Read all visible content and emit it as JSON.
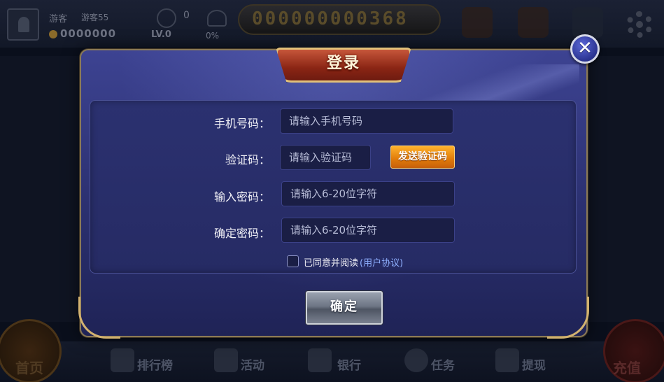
{
  "background": {
    "player_name": "游客",
    "player_id": "游客55",
    "coins": "0000000",
    "vip_value": "0",
    "level": "LV.0",
    "percent": "0%",
    "jackpot": "000000000368",
    "bottom_nav": [
      "首页",
      "排行榜",
      "活动",
      "银行",
      "任务",
      "提现",
      "充值"
    ]
  },
  "modal": {
    "title": "登录",
    "close_symbol": "✕",
    "fields": {
      "phone": {
        "label": "手机号码：",
        "placeholder": "请输入手机号码"
      },
      "code": {
        "label": "验证码：",
        "placeholder": "请输入验证码"
      },
      "password": {
        "label": "输入密码：",
        "placeholder": "请输入6-20位字符"
      },
      "confirm_password": {
        "label": "确定密码：",
        "placeholder": "请输入6-20位字符"
      }
    },
    "send_code_label": "发送验证码",
    "agree_text": "已同意并阅读",
    "agreement_link": "(用户协议)",
    "confirm_label": "确定"
  },
  "colors": {
    "modal_bg": "#2b3070",
    "accent_orange": "#e07a09",
    "title_red": "#8a2514",
    "gold_border": "#d2b270",
    "link_blue": "#8fb0ff"
  }
}
